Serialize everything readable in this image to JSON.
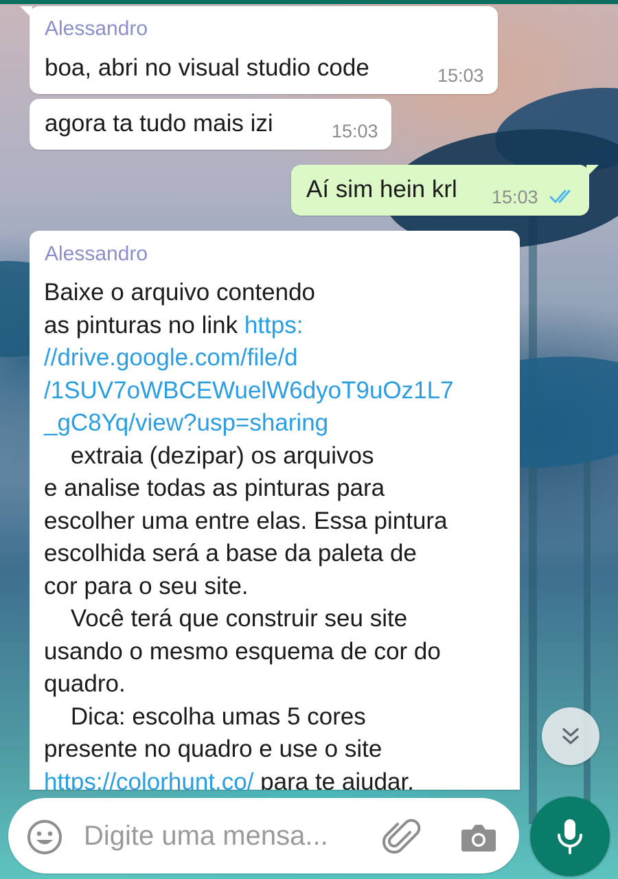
{
  "messages": [
    {
      "sender": "Alessandro",
      "text": "boa, abri no visual studio code",
      "time": "15:03"
    },
    {
      "text": "agora ta tudo mais izi",
      "time": "15:03"
    },
    {
      "text": "Aí sim hein krl",
      "time": "15:03",
      "status": "read"
    },
    {
      "sender": "Alessandro",
      "lines": {
        "l1": "Baixe o arquivo contendo",
        "l2a": "as pinturas no link ",
        "l2b": "https:",
        "l3": "//drive.google.com/file/d",
        "l4": "/1SUV7oWBCEWuelW6dyoT9uOz1L7",
        "l5": "_gC8Yq/view?usp=sharing",
        "l6": "    extraia (dezipar) os arquivos",
        "l7": "e analise todas as pinturas para",
        "l8": "escolher uma entre elas. Essa pintura",
        "l9": "escolhida será a base da paleta de",
        "l10": "cor para o seu site.",
        "l11": "    Você terá que construir seu site",
        "l12": "usando o mesmo esquema de cor do",
        "l13": "quadro.",
        "l14": "    Dica: escolha umas 5 cores",
        "l15": "presente no quadro e use o site",
        "l16a": "https://colorhunt.co/",
        "l16b": " para te ajudar."
      }
    }
  ],
  "composer": {
    "placeholder": "Digite uma mensa...",
    "emoji_icon": "emoji-icon",
    "attach_icon": "paperclip-icon",
    "camera_icon": "camera-icon",
    "mic_icon": "microphone-icon"
  },
  "scroll_down_icon": "double-chevron-down-icon",
  "colors": {
    "incoming": "#ffffff",
    "outgoing": "#dcf8c6",
    "sender": "#8a8fc9",
    "link": "#2a9ee0",
    "read_ticks": "#4fb6ec",
    "mic": "#0a7d6a"
  }
}
